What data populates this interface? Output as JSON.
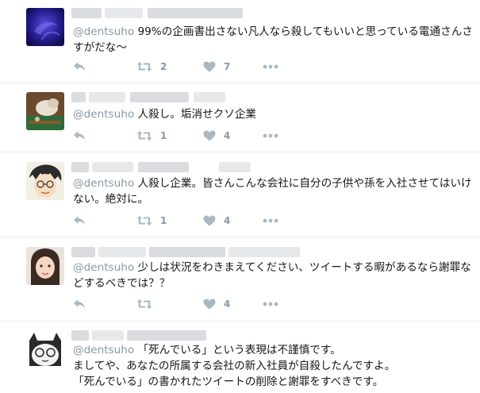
{
  "tweets": [
    {
      "mention": "@dentsuho",
      "body": " 99%の企画書出さない凡人なら殺してもいいと思っている電通さんさすがだな〜",
      "retweets": "2",
      "likes": "7"
    },
    {
      "mention": "@dentsuho",
      "body": " 人殺し。垢消せクソ企業",
      "retweets": "1",
      "likes": "4"
    },
    {
      "mention": "@dentsuho",
      "body": " 人殺し企業。皆さんこんな会社に自分の子供や孫を入社させてはいけない。絶対に。",
      "retweets": "1",
      "likes": "4"
    },
    {
      "mention": "@dentsuho",
      "body": " 少しは状況をわきまえてください、ツイートする暇があるなら謝罪などするべきでは？？",
      "retweets": "",
      "likes": "4"
    },
    {
      "mention": "@dentsuho",
      "body": " 「死んでいる」という表現は不謹慎です。",
      "line2": "ましてや、あなたの所属する会社の新入社員が自殺したんですよ。",
      "line3": "「死んでいる」の書かれたツイートの削除と謝罪をすべきです。"
    }
  ],
  "icons": {
    "reply": "reply-icon",
    "retweet": "retweet-icon",
    "like": "heart-icon",
    "more": "more-icon"
  },
  "colors": {
    "action_gray": "#aab8c2",
    "mention_gray": "#8899a6",
    "divider": "#e6ecf0"
  }
}
